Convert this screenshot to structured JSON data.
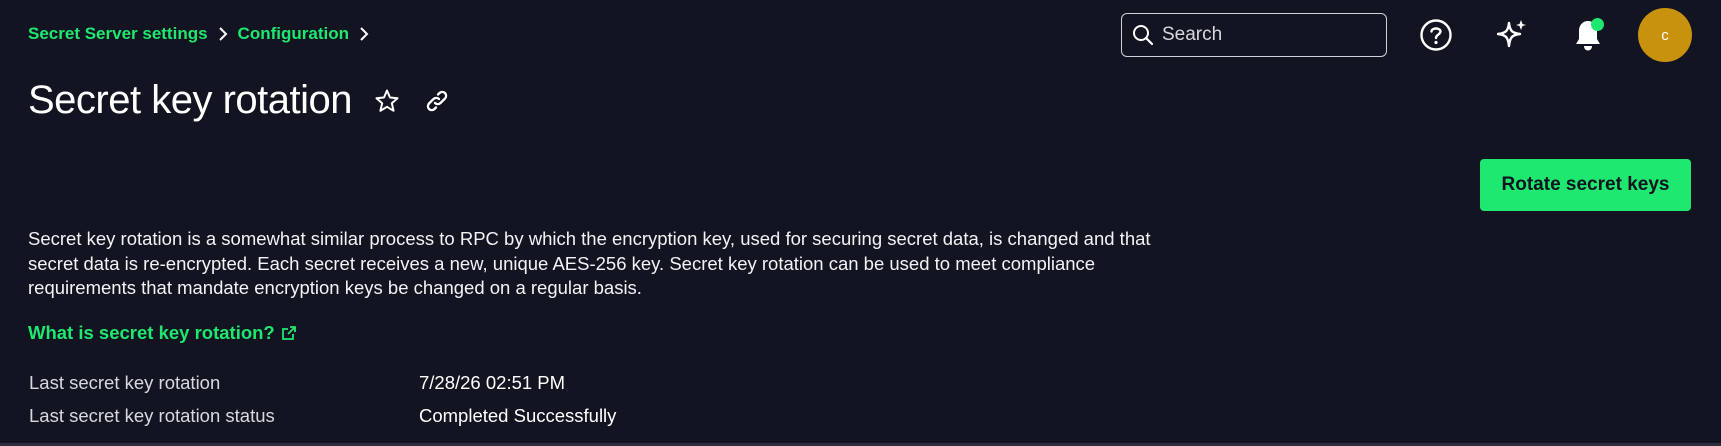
{
  "breadcrumb": {
    "items": [
      {
        "label": "Secret Server settings"
      },
      {
        "label": "Configuration"
      }
    ]
  },
  "search": {
    "placeholder": "Search",
    "value": ""
  },
  "header_icons": [
    "help-icon",
    "sparkle-icon",
    "bell-icon"
  ],
  "avatar": {
    "initial": "c",
    "color": "#c8920e"
  },
  "page": {
    "title": "Secret key rotation",
    "rotate_button": "Rotate secret keys",
    "description": "Secret key rotation is a somewhat similar process to RPC by which the encryption key, used for securing secret data, is changed and that secret data is re-encrypted. Each secret receives a new, unique AES-256 key. Secret key rotation can be used to meet compliance requirements that mandate encryption keys be changed on a regular basis.",
    "learn_link": "What is secret key rotation?"
  },
  "details": [
    {
      "label": "Last secret key rotation",
      "value": "7/28/26 02:51 PM"
    },
    {
      "label": "Last secret key rotation status",
      "value": "Completed Successfully"
    }
  ],
  "colors": {
    "background": "#121421",
    "accent": "#1fe870",
    "avatar": "#c8920e",
    "notification_dot": "#1fe870"
  }
}
